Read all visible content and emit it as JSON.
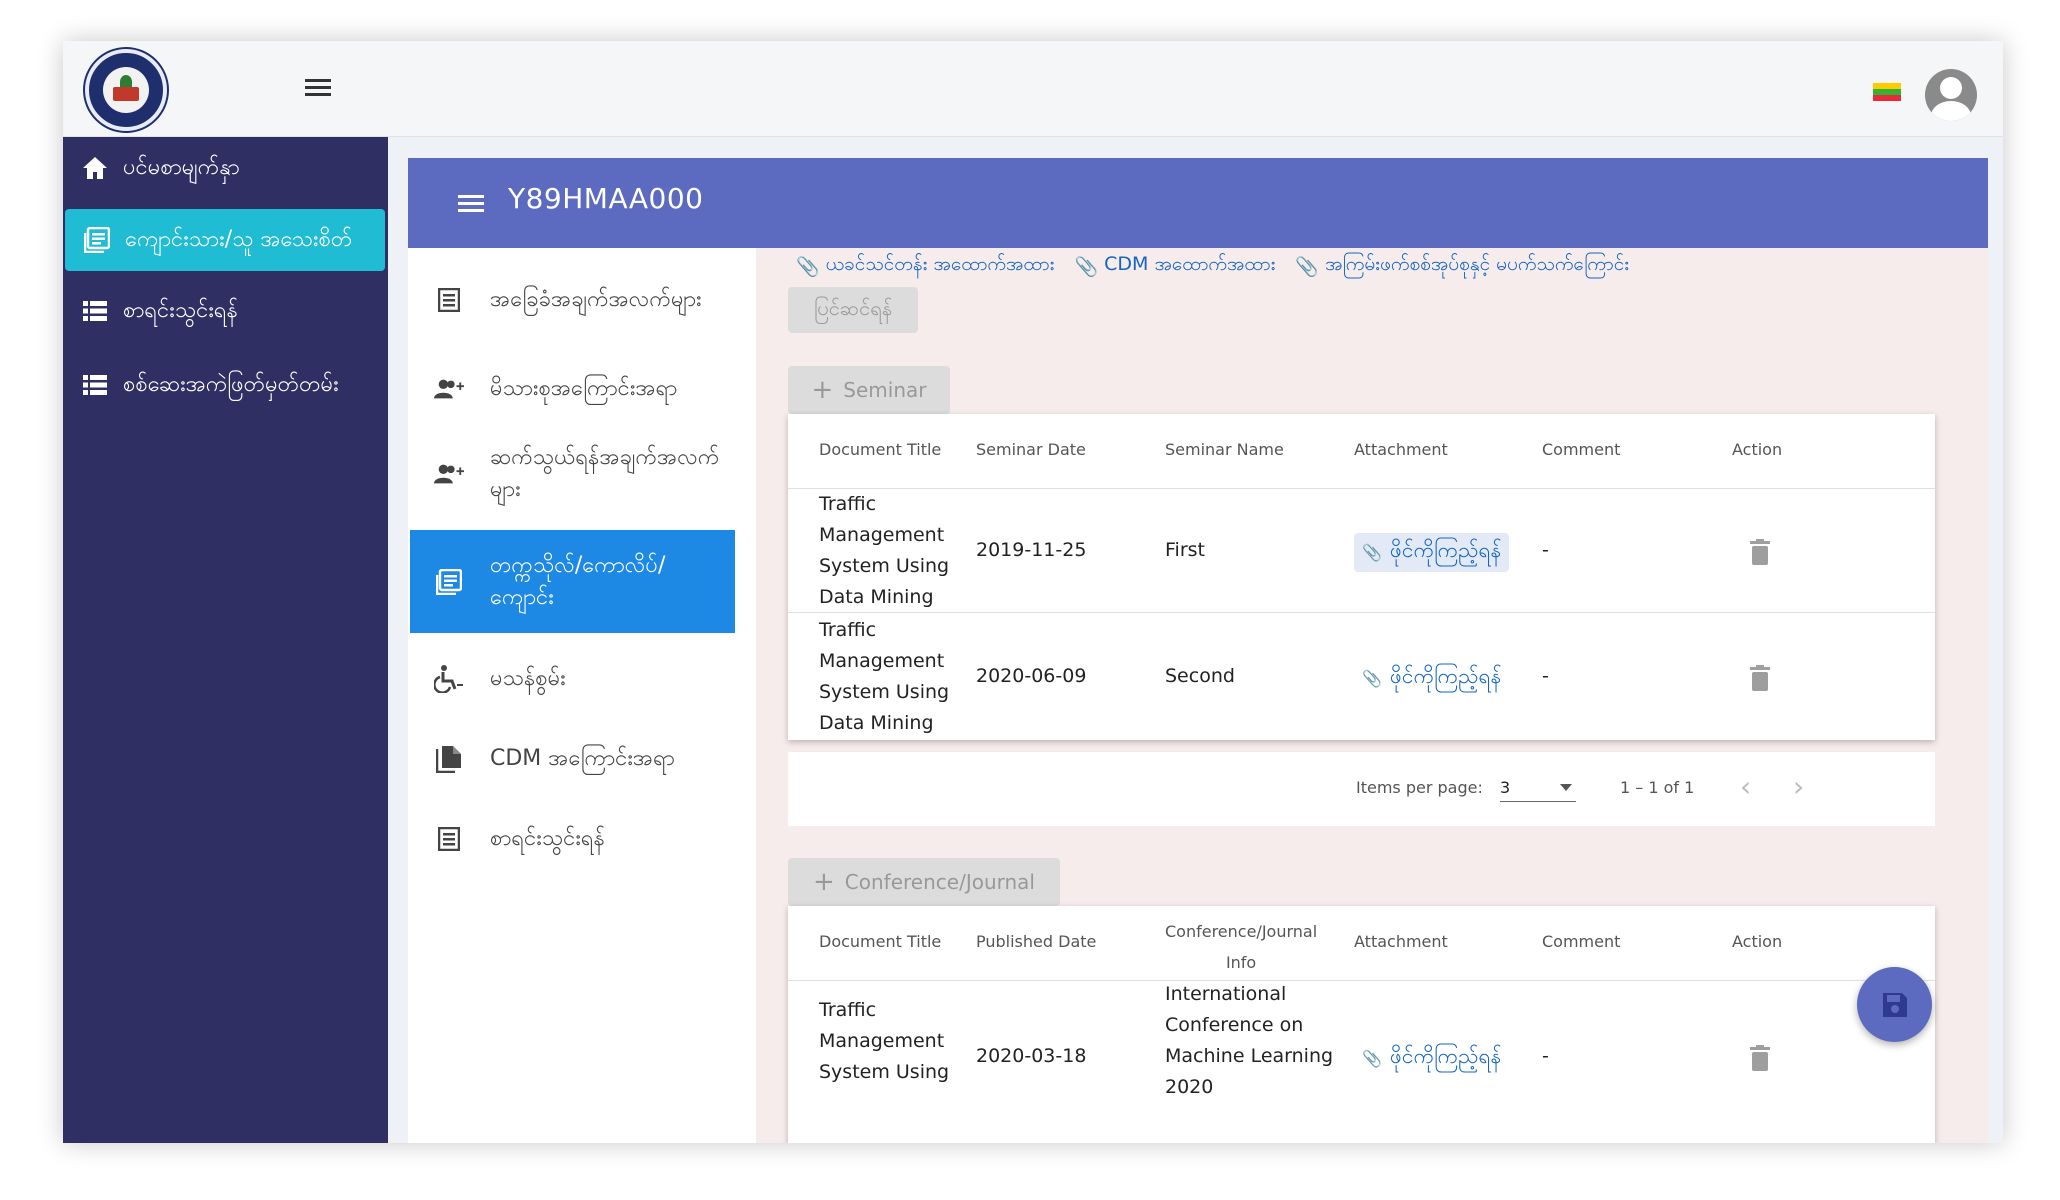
{
  "app": {
    "colors": {
      "sidebar": "#2f2f64",
      "sidebar_active": "#1fbcd3",
      "header": "#5c6bc0",
      "nav_active": "#1e88e5",
      "link": "#1565c0"
    }
  },
  "sidebar": {
    "items": [
      {
        "label": "ပင်မစာမျက်နှာ",
        "icon": "home-icon"
      },
      {
        "label": "ကျောင်းသား/သူ အသေးစိတ်",
        "icon": "article-icon"
      },
      {
        "label": "စာရင်းသွင်းရန်",
        "icon": "list-icon"
      },
      {
        "label": "စစ်ဆေးအကဲဖြတ်မှတ်တမ်း",
        "icon": "list-icon"
      }
    ]
  },
  "header": {
    "title": "Y89HMAA000",
    "menu_icon": "menu-icon"
  },
  "nav": {
    "items": [
      {
        "label": "အခြေခံအချက်အလက်များ",
        "icon": "document-icon"
      },
      {
        "label": "မိသားစုအကြောင်းအရာ",
        "icon": "group-add-icon"
      },
      {
        "label": "ဆက်သွယ်ရန်အချက်အလက်များ",
        "icon": "group-add-icon"
      },
      {
        "label": "တက္ကသိုလ်/ကောလိပ်/ကျောင်း",
        "icon": "article-icon"
      },
      {
        "label": "မသန်စွမ်း",
        "icon": "accessible-icon"
      },
      {
        "label": "CDM အကြောင်းအရာ",
        "icon": "file-copy-icon"
      },
      {
        "label": "စာရင်းသွင်းရန်",
        "icon": "document-icon"
      }
    ]
  },
  "links": [
    "ယခင်သင်တန်း အထောက်အထား",
    "CDM အထောက်အထား",
    "အကြမ်းဖက်စစ်အုပ်စုနှင့် မပက်သက်ကြောင်း"
  ],
  "edit_button": "ပြင်ဆင်ရန်",
  "seminar": {
    "add_label": "Seminar",
    "headers": [
      "Document Title",
      "Seminar Date",
      "Seminar Name",
      "Attachment",
      "Comment",
      "Action"
    ],
    "rows": [
      {
        "title_lines": [
          "Traffic",
          "Management",
          "System Using",
          "Data Mining"
        ],
        "date": "2019-11-25",
        "name": "First",
        "attachment": "ဖိုင်ကိုကြည့်ရန်",
        "comment": "-"
      },
      {
        "title_lines": [
          "Traffic",
          "Management",
          "System Using",
          "Data Mining"
        ],
        "date": "2020-06-09",
        "name": "Second",
        "attachment": "ဖိုင်ကိုကြည့်ရန်",
        "comment": "-"
      }
    ],
    "pager": {
      "items_label": "Items per page:",
      "page_size": "3",
      "range": "1 – 1 of 1"
    }
  },
  "conference": {
    "add_label": "Conference/Journal",
    "headers": [
      "Document Title",
      "Published Date",
      "Conference/Journal Info",
      "Attachment",
      "Comment",
      "Action"
    ],
    "header_info_lines": [
      "Conference/Journal",
      "Info"
    ],
    "rows": [
      {
        "title_lines": [
          "Traffic",
          "Management",
          "System Using"
        ],
        "date": "2020-03-18",
        "info_lines": [
          "International",
          "Conference on",
          "Machine Learning",
          "2020"
        ],
        "attachment": "ဖိုင်ကိုကြည့်ရန်",
        "comment": "-"
      }
    ]
  }
}
